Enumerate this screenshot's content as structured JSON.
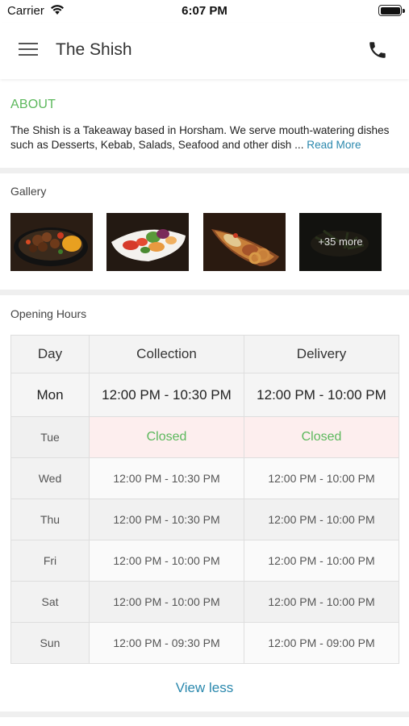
{
  "status_bar": {
    "carrier": "Carrier",
    "time": "6:07 PM"
  },
  "header": {
    "title": "The Shish",
    "menu_icon": "hamburger-menu-icon",
    "call_icon": "phone-icon"
  },
  "about": {
    "heading": "ABOUT",
    "text": "The Shish is a Takeaway based in Horsham. We serve mouth-watering dishes such as Desserts, Kebab, Salads, Seafood and other dish ...",
    "read_more": "Read More"
  },
  "gallery": {
    "label": "Gallery",
    "more_label": "+35 more"
  },
  "opening_hours": {
    "label": "Opening Hours",
    "columns": [
      "Day",
      "Collection",
      "Delivery"
    ],
    "rows": [
      {
        "day": "Mon",
        "collection": "12:00 PM - 10:30 PM",
        "delivery": "12:00 PM - 10:00 PM"
      },
      {
        "day": "Tue",
        "collection": "Closed",
        "delivery": "Closed"
      },
      {
        "day": "Wed",
        "collection": "12:00 PM - 10:30 PM",
        "delivery": "12:00 PM - 10:00 PM"
      },
      {
        "day": "Thu",
        "collection": "12:00 PM - 10:30 PM",
        "delivery": "12:00 PM - 10:00 PM"
      },
      {
        "day": "Fri",
        "collection": "12:00 PM - 10:00 PM",
        "delivery": "12:00 PM - 10:00 PM"
      },
      {
        "day": "Sat",
        "collection": "12:00 PM - 10:00 PM",
        "delivery": "12:00 PM - 10:00 PM"
      },
      {
        "day": "Sun",
        "collection": "12:00 PM - 09:30 PM",
        "delivery": "12:00 PM - 09:00 PM"
      }
    ],
    "view_less": "View less"
  },
  "colors": {
    "accent_green": "#5cb85c",
    "link_blue": "#2a88ad",
    "closed_bg": "#fdeeee"
  }
}
